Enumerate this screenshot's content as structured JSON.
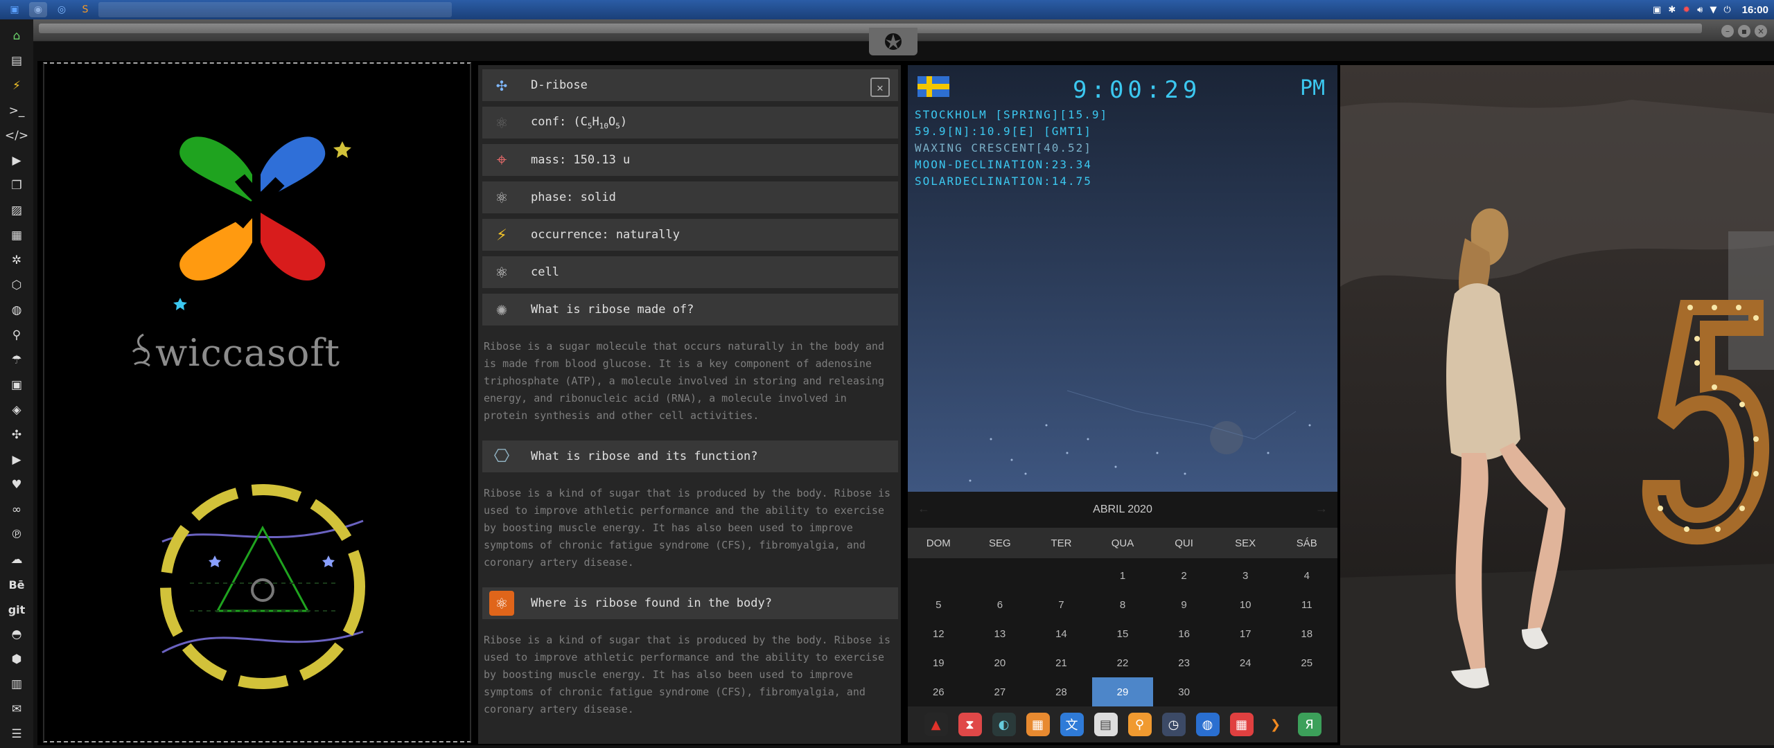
{
  "taskbar": {
    "apps": [
      {
        "icon": "files-icon",
        "glyph": "▣",
        "color": "#5aa0ff",
        "active": false
      },
      {
        "icon": "app-window-icon",
        "glyph": "◉",
        "color": "#8fb0e0",
        "active": true
      },
      {
        "icon": "chrome-icon",
        "glyph": "◎",
        "color": "#7fb8ff",
        "active": false
      },
      {
        "icon": "sublime-icon",
        "glyph": "S",
        "color": "#f59a27",
        "active": false
      }
    ],
    "clock": "16:00"
  },
  "dock": {
    "items": [
      {
        "name": "home-icon",
        "glyph": "⌂",
        "color": "#6cd46c"
      },
      {
        "name": "document-icon",
        "glyph": "▤"
      },
      {
        "name": "lightning-icon",
        "glyph": "⚡",
        "color": "#f2c32a"
      },
      {
        "name": "terminal-icon",
        "glyph": ">_"
      },
      {
        "name": "code-icon",
        "glyph": "</>"
      },
      {
        "name": "play-icon",
        "glyph": "▶"
      },
      {
        "name": "copy-icon",
        "glyph": "❐"
      },
      {
        "name": "image-icon",
        "glyph": "▨"
      },
      {
        "name": "news-icon",
        "glyph": "▦"
      },
      {
        "name": "settings-icon",
        "glyph": "✲"
      },
      {
        "name": "hexagon-icon",
        "glyph": "⬡"
      },
      {
        "name": "globe-icon",
        "glyph": "◍"
      },
      {
        "name": "search-icon",
        "glyph": "⚲"
      },
      {
        "name": "umbrella-icon",
        "glyph": "☂"
      },
      {
        "name": "contact-icon",
        "glyph": "▣"
      },
      {
        "name": "tag-icon",
        "glyph": "◈"
      },
      {
        "name": "expand-icon",
        "glyph": "✣"
      },
      {
        "name": "youtube-icon",
        "glyph": "▶"
      },
      {
        "name": "heart-icon",
        "glyph": "♥"
      },
      {
        "name": "infinity-icon",
        "glyph": "∞"
      },
      {
        "name": "pinterest-icon",
        "glyph": "℗"
      },
      {
        "name": "cloud-icon",
        "glyph": "☁"
      },
      {
        "name": "behance-icon",
        "label": "Bē"
      },
      {
        "name": "git-icon",
        "label": "git"
      },
      {
        "name": "github-icon",
        "glyph": "◓"
      },
      {
        "name": "cubes-icon",
        "glyph": "⬢"
      },
      {
        "name": "map-icon",
        "glyph": "▥"
      },
      {
        "name": "mail-icon",
        "glyph": "✉"
      },
      {
        "name": "server-icon",
        "glyph": "☰"
      }
    ]
  },
  "brand": {
    "name": "wiccasoft",
    "colors": {
      "green": "#1fa31f",
      "blue": "#2f6fd8",
      "orange": "#ff9a10",
      "red": "#d81c1c",
      "yellow": "#d2c23a"
    }
  },
  "info": {
    "rows": [
      {
        "icon": "molecule-icon",
        "text": "D-ribose"
      },
      {
        "icon": "atom-icon",
        "text": "conf: (C5H10O5)"
      },
      {
        "icon": "map-pin-icon",
        "text": "mass: 150.13 u"
      },
      {
        "icon": "atom-orbit-icon",
        "text": "phase: solid"
      },
      {
        "icon": "lightning-icon",
        "text": "occurrence: naturally"
      },
      {
        "icon": "react-icon",
        "text": "cell"
      },
      {
        "icon": "sparkle-atom-icon",
        "text": "What is ribose made of?"
      }
    ],
    "formula": {
      "prefix": "conf: (C",
      "c": "5",
      "h": "H",
      "hn": "10",
      "o": "O",
      "on": "5",
      "suffix": ")"
    },
    "answer1": "Ribose is a sugar molecule that occurs naturally in the body and is made from blood glucose. It is a key component of adenosine triphosphate (ATP), a molecule involved in storing and releasing energy, and ribonucleic acid (RNA), a molecule involved in protein synthesis and other cell activities.",
    "question2": "What is ribose and its function?",
    "answer2": "Ribose is a kind of sugar that is produced by the body. Ribose is used to improve athletic performance and the ability to exercise by boosting muscle energy. It has also been used to improve symptoms of chronic fatigue syndrome (CFS), fibromyalgia, and coronary artery disease.",
    "question3": "Where is ribose found in the body?",
    "answer3": "Ribose is a kind of sugar that is produced by the body. Ribose is used to improve athletic performance and the ability to exercise by boosting muscle energy. It has also been used to improve symptoms of chronic fatigue syndrome (CFS), fibromyalgia, and coronary artery disease."
  },
  "sky": {
    "time": "9:00:29",
    "ampm": "PM",
    "lines": [
      "STOCKHOLM [SPRING][15.9]",
      "59.9[N]:10.9[E] [GMT1]",
      "WAXING CRESCENT[40.52]",
      "MOON-DECLINATION:23.34",
      "SOLARDECLINATION:14.75"
    ],
    "accent": "#3cc8f0"
  },
  "calendar": {
    "title": "ABRIL 2020",
    "prev": "←",
    "next": "→",
    "dow": [
      "DOM",
      "SEG",
      "TER",
      "QUA",
      "QUI",
      "SEX",
      "SÁB"
    ],
    "weeks": [
      [
        "",
        "",
        "",
        "1",
        "2",
        "3",
        "4"
      ],
      [
        "5",
        "6",
        "7",
        "8",
        "9",
        "10",
        "11"
      ],
      [
        "12",
        "13",
        "14",
        "15",
        "16",
        "17",
        "18"
      ],
      [
        "19",
        "20",
        "21",
        "22",
        "23",
        "24",
        "25"
      ],
      [
        "26",
        "27",
        "28",
        "29",
        "30",
        "",
        ""
      ]
    ],
    "today": "29",
    "today_color": "#4d86c9"
  },
  "launcher": [
    {
      "name": "acrobat-icon",
      "glyph": "▲",
      "bg": "#262626",
      "color": "#e0322a"
    },
    {
      "name": "timer-icon",
      "glyph": "⧗",
      "bg": "#e04848",
      "color": "#fff"
    },
    {
      "name": "planet-icon",
      "glyph": "◐",
      "bg": "#2a3a3a",
      "color": "#6cd"
    },
    {
      "name": "photos-icon",
      "glyph": "▦",
      "bg": "#e88a30",
      "color": "#fff"
    },
    {
      "name": "translate-icon",
      "glyph": "文",
      "bg": "#2f7bd8",
      "color": "#fff"
    },
    {
      "name": "notes-icon",
      "glyph": "▤",
      "bg": "#ddd",
      "color": "#444"
    },
    {
      "name": "search-app-icon",
      "glyph": "⚲",
      "bg": "#f09a30",
      "color": "#fff"
    },
    {
      "name": "clock-app-icon",
      "glyph": "◷",
      "bg": "#3c4a66",
      "color": "#fff"
    },
    {
      "name": "web-icon",
      "glyph": "◍",
      "bg": "#2a6fd0",
      "color": "#fff"
    },
    {
      "name": "calendar-app-icon",
      "glyph": "▦",
      "bg": "#e04040",
      "color": "#fff"
    },
    {
      "name": "arrow-app-icon",
      "glyph": "❯",
      "bg": "#242424",
      "color": "#f28a20"
    },
    {
      "name": "yandex-icon",
      "glyph": "Я",
      "bg": "#3ca05a",
      "color": "#fff"
    }
  ]
}
